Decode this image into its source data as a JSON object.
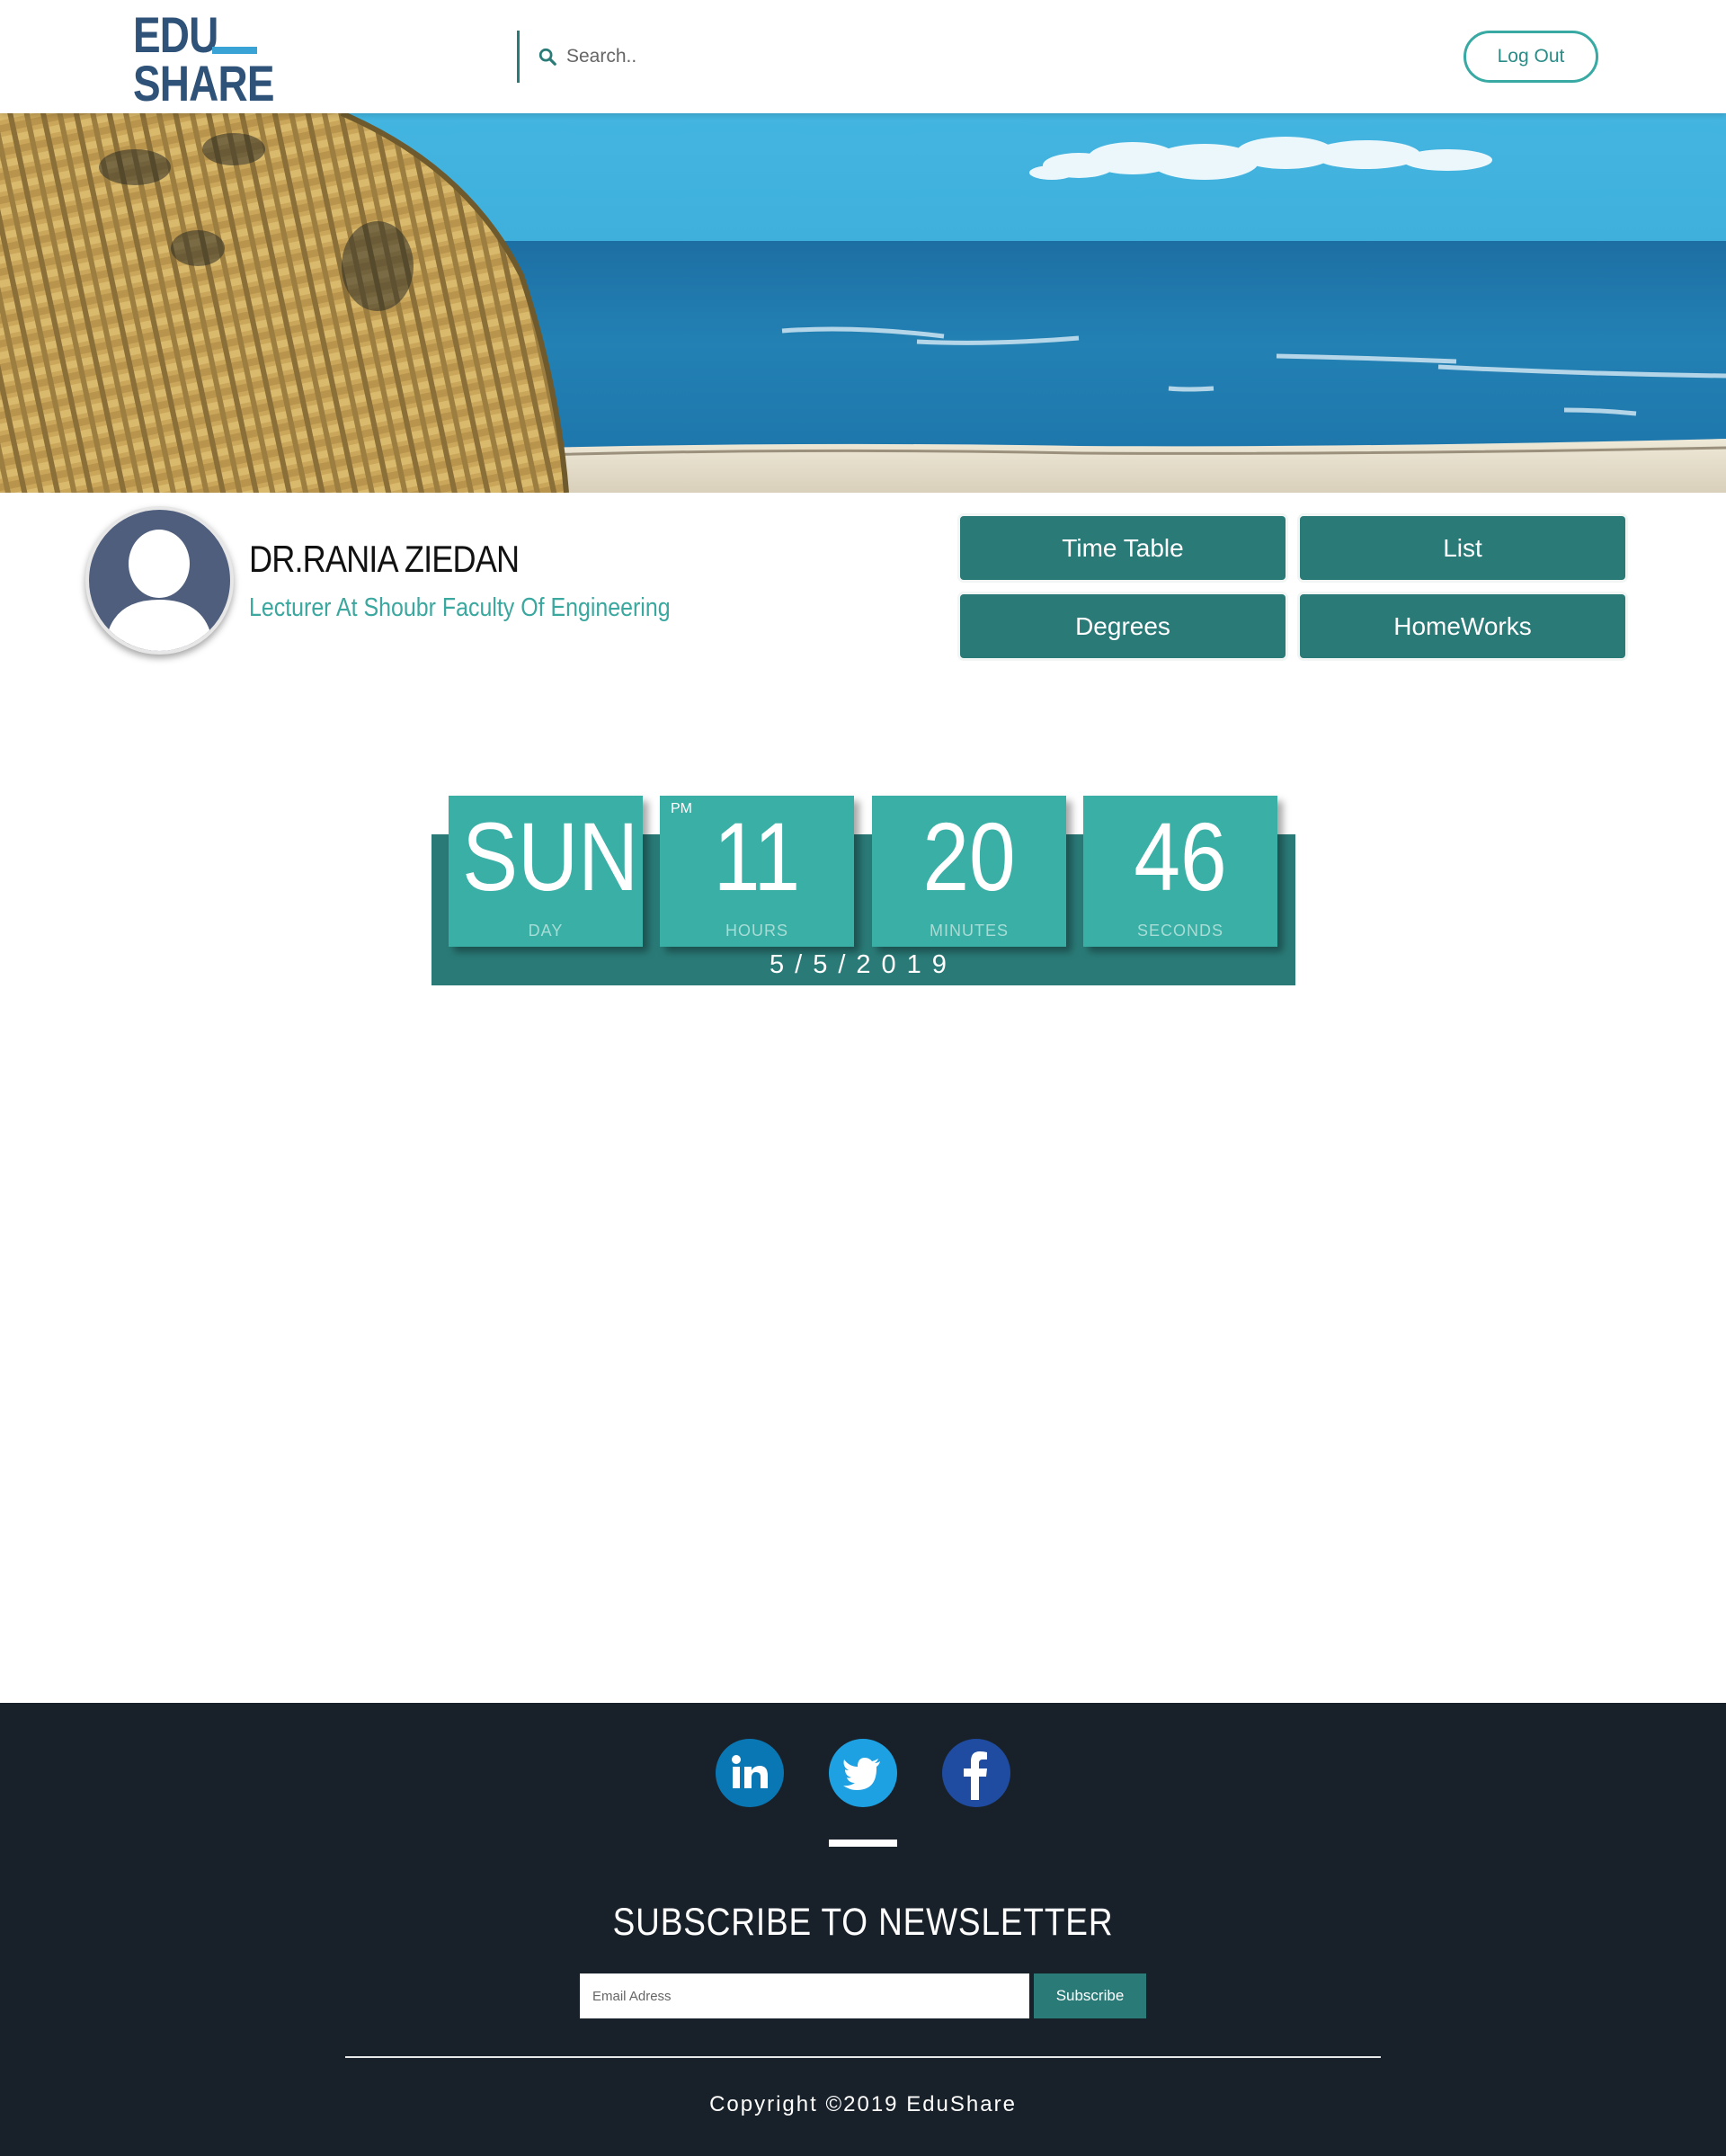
{
  "header": {
    "logo_line1": "EDU",
    "logo_line2": "SHARE",
    "search_placeholder": "Search..",
    "logout_label": "Log Out"
  },
  "banner": {
    "image": "beach-wicker-chair-photo"
  },
  "profile": {
    "name": "DR.RANIA ZIEDAN",
    "role": "Lecturer At Shoubr Faculty Of Engineering",
    "buttons": [
      "Time Table",
      "List",
      "Degrees",
      "HomeWorks"
    ]
  },
  "clock": {
    "day": {
      "value": "SUN",
      "label": "DAY"
    },
    "hours": {
      "value": "11",
      "label": "HOURS",
      "ampm": "PM"
    },
    "minutes": {
      "value": "20",
      "label": "MINUTES"
    },
    "seconds": {
      "value": "46",
      "label": "SECONDS"
    },
    "date": "5/5/2019"
  },
  "footer": {
    "social": [
      "linkedin",
      "twitter",
      "facebook"
    ],
    "newsletter_title": "SUBSCRIBE TO NEWSLETTER",
    "email_placeholder": "Email Adress",
    "subscribe_label": "Subscribe",
    "copyright": "Copyright ©2019 EduShare"
  },
  "colors": {
    "brand_teal": "#2a7b78",
    "tile_teal": "#3aafa6",
    "logo_blue": "#2f5278",
    "footer_bg": "#18212a",
    "linkedin": "#0a77b5",
    "twitter": "#1da1e2",
    "facebook": "#1f4ba0"
  }
}
